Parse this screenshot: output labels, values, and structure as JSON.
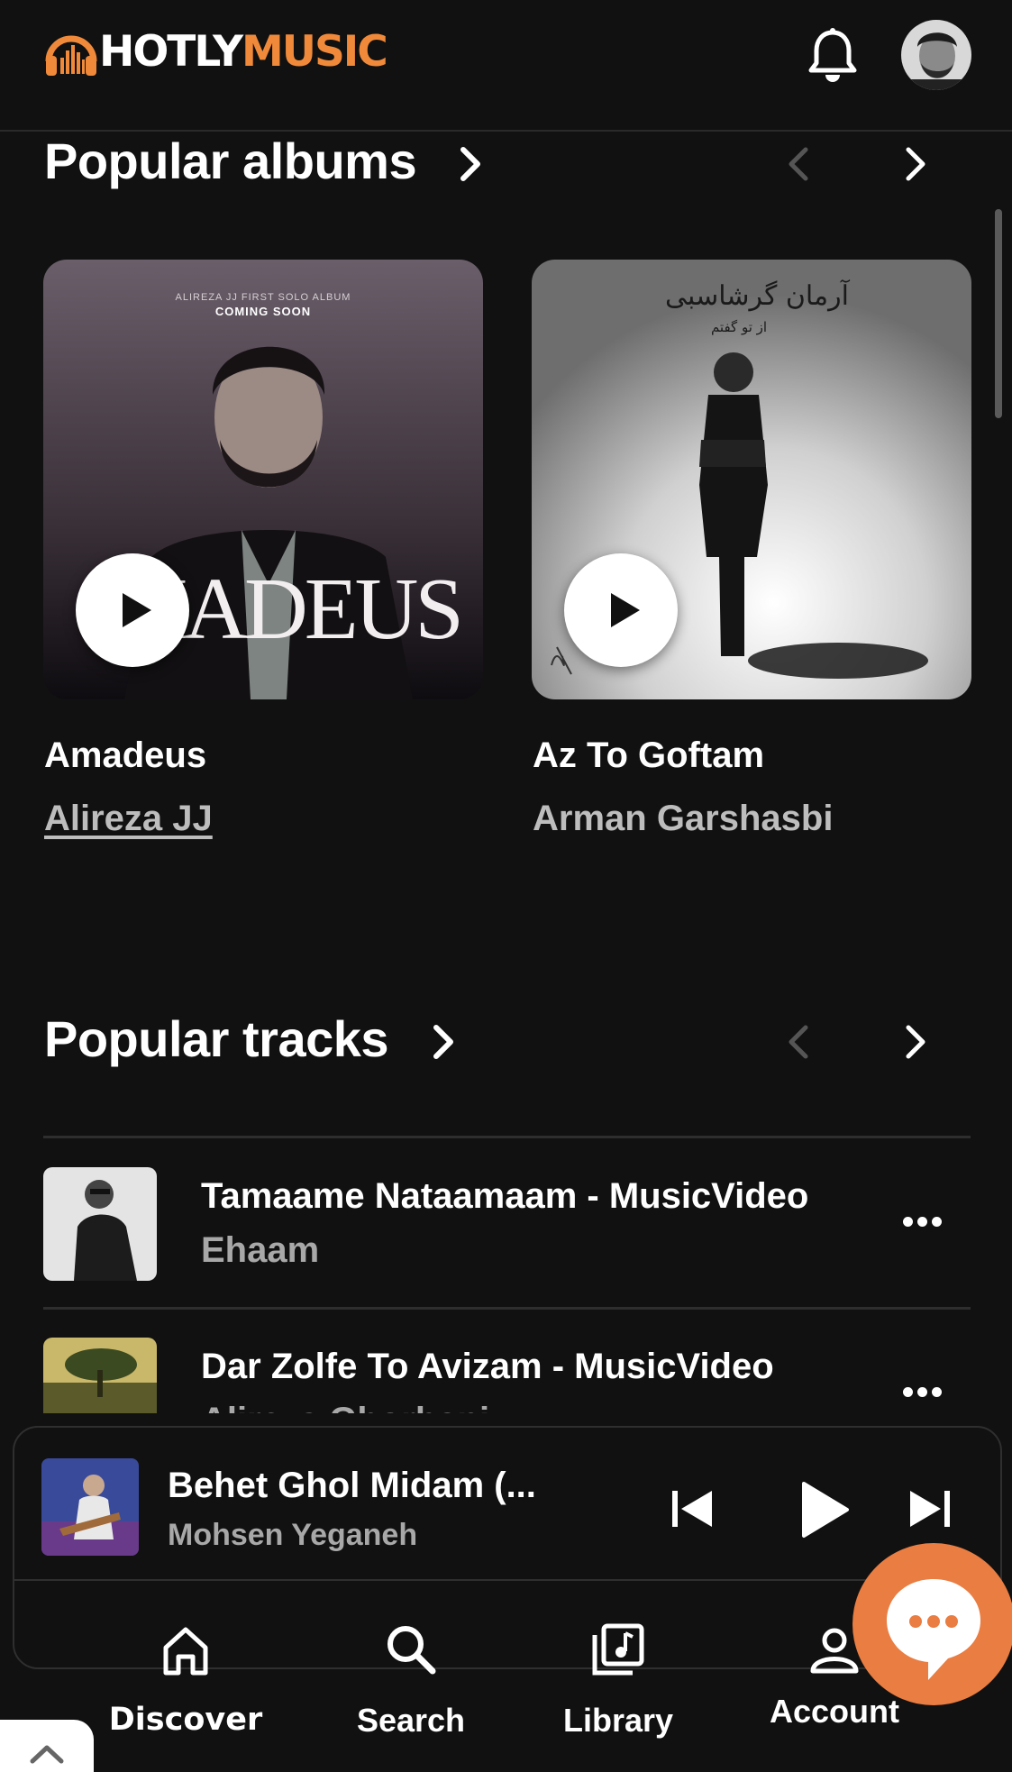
{
  "header": {
    "logo_hotly": "HOTLY",
    "logo_music": "MUSIC",
    "brand_color": "#f08a3a"
  },
  "albums_section": {
    "title": "Popular albums",
    "items": [
      {
        "title": "Amadeus",
        "artist": "Alireza JJ",
        "art_caption_top": "ALIREZA JJ FIRST SOLO ALBUM",
        "art_caption_sub": "COMING SOON",
        "art_word": "MADEUS"
      },
      {
        "title": "Az To Goftam",
        "artist": "Arman Garshasbi",
        "art_caption_top": "آرمان گرشاسبی",
        "art_caption_sub": "از تو گفتم"
      }
    ]
  },
  "tracks_section": {
    "title": "Popular tracks",
    "items": [
      {
        "title": "Tamaame Nataamaam - MusicVideo",
        "artist": "Ehaam"
      },
      {
        "title": "Dar Zolfe To Avizam - MusicVideo",
        "artist": "Alireza Ghorbani"
      }
    ]
  },
  "player": {
    "title": "Behet Ghol Midam (...",
    "artist": "Mohsen Yeganeh"
  },
  "nav": {
    "items": [
      {
        "label": "Discover",
        "icon": "home-icon",
        "active": true
      },
      {
        "label": "Search",
        "icon": "search-icon"
      },
      {
        "label": "Library",
        "icon": "library-icon"
      },
      {
        "label": "Account",
        "icon": "account-icon"
      }
    ]
  },
  "colors": {
    "background": "#111111",
    "accent": "#e97d42",
    "muted_text": "#a8a8a8"
  }
}
